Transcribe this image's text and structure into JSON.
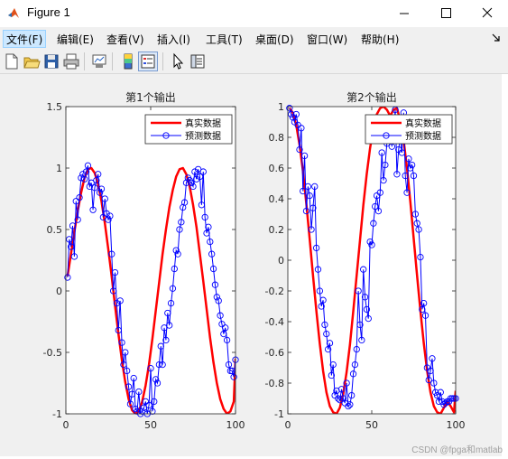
{
  "window": {
    "title": "Figure 1"
  },
  "menu": [
    {
      "label": "文件(F)"
    },
    {
      "label": "编辑(E)"
    },
    {
      "label": "查看(V)"
    },
    {
      "label": "插入(I)"
    },
    {
      "label": "工具(T)"
    },
    {
      "label": "桌面(D)"
    },
    {
      "label": "窗口(W)"
    },
    {
      "label": "帮助(H)"
    }
  ],
  "watermark": "CSDN @fpga和matlab",
  "colors": {
    "real": "#ff0000",
    "pred": "#0000ff",
    "figure_bg": "#f0f0f0",
    "accent": "#0078d7"
  },
  "chart_data": [
    {
      "type": "line",
      "title": "第1个输出",
      "xlim": [
        0,
        100
      ],
      "ylim": [
        -1,
        1.5
      ],
      "xticks": [
        0,
        50,
        100
      ],
      "yticks": [
        -1,
        -0.5,
        0,
        0.5,
        1,
        1.5
      ],
      "legend_position": "top-right",
      "grid": false,
      "series": [
        {
          "name": "真实数据",
          "x": [
            1,
            3,
            5,
            7,
            9,
            11,
            13,
            15,
            17,
            19,
            21,
            23,
            25,
            27,
            29,
            31,
            33,
            35,
            37,
            39,
            41,
            43,
            45,
            47,
            49,
            51,
            53,
            55,
            57,
            59,
            61,
            63,
            65,
            67,
            69,
            71,
            73,
            75,
            77,
            79,
            81,
            83,
            85,
            87,
            89,
            91,
            93,
            95,
            97,
            99,
            100
          ],
          "y": [
            0.12,
            0.3,
            0.48,
            0.65,
            0.8,
            0.92,
            0.99,
            1.0,
            0.96,
            0.87,
            0.73,
            0.55,
            0.34,
            0.12,
            -0.12,
            -0.35,
            -0.56,
            -0.74,
            -0.88,
            -0.97,
            -1.0,
            -0.98,
            -0.9,
            -0.77,
            -0.6,
            -0.39,
            -0.16,
            0.07,
            0.3,
            0.5,
            0.68,
            0.82,
            0.93,
            0.99,
            1.0,
            0.95,
            0.85,
            0.7,
            0.52,
            0.3,
            0.08,
            -0.15,
            -0.38,
            -0.58,
            -0.75,
            -0.88,
            -0.96,
            -1.0,
            -0.98,
            -0.9,
            -0.55
          ]
        },
        {
          "name": "预测数据",
          "x": [
            1,
            2,
            3,
            4,
            5,
            6,
            7,
            8,
            9,
            10,
            11,
            12,
            13,
            14,
            15,
            16,
            17,
            18,
            19,
            20,
            21,
            22,
            23,
            24,
            25,
            26,
            27,
            28,
            29,
            30,
            31,
            32,
            33,
            34,
            35,
            36,
            37,
            38,
            39,
            40,
            41,
            42,
            43,
            44,
            45,
            46,
            47,
            48,
            49,
            50,
            51,
            52,
            53,
            54,
            55,
            56,
            57,
            58,
            59,
            60,
            61,
            62,
            63,
            64,
            65,
            66,
            67,
            68,
            69,
            70,
            71,
            72,
            73,
            74,
            75,
            76,
            77,
            78,
            79,
            80,
            81,
            82,
            83,
            84,
            85,
            86,
            87,
            88,
            89,
            90,
            91,
            92,
            93,
            94,
            95,
            96,
            97,
            98,
            99,
            100
          ],
          "y": [
            0.11,
            0.42,
            0.36,
            0.53,
            0.28,
            0.73,
            0.58,
            0.76,
            0.92,
            0.95,
            0.91,
            0.97,
            1.02,
            0.85,
            0.88,
            0.66,
            0.84,
            0.9,
            0.95,
            0.8,
            0.83,
            0.6,
            0.75,
            0.63,
            0.58,
            0.61,
            0.3,
            0.0,
            0.15,
            -0.1,
            -0.32,
            -0.08,
            -0.42,
            -0.6,
            -0.5,
            -0.65,
            -0.78,
            -0.92,
            -0.84,
            -0.71,
            -0.96,
            -0.98,
            -0.82,
            -1.0,
            -0.98,
            -0.95,
            -0.9,
            -1.0,
            -0.93,
            -0.63,
            -0.98,
            -0.9,
            -0.72,
            -0.75,
            -0.6,
            -0.45,
            -0.6,
            -0.3,
            -0.4,
            -0.18,
            -0.28,
            -0.1,
            0.02,
            0.18,
            0.33,
            0.3,
            0.5,
            0.56,
            0.68,
            0.72,
            0.88,
            0.92,
            0.9,
            0.88,
            0.85,
            0.97,
            0.91,
            0.99,
            0.93,
            0.7,
            0.97,
            0.6,
            0.47,
            0.52,
            0.4,
            0.3,
            0.18,
            0.05,
            -0.05,
            -0.08,
            -0.2,
            -0.27,
            -0.35,
            -0.3,
            -0.4,
            -0.6,
            -0.65,
            -0.65,
            -0.7,
            -0.56
          ]
        }
      ]
    },
    {
      "type": "line",
      "title": "第2个输出",
      "xlim": [
        0,
        100
      ],
      "ylim": [
        -1,
        1
      ],
      "xticks": [
        0,
        50,
        100
      ],
      "yticks": [
        -1,
        -0.8,
        -0.6,
        -0.4,
        -0.2,
        0,
        0.2,
        0.4,
        0.6,
        0.8,
        1
      ],
      "legend_position": "top-right",
      "grid": false,
      "series": [
        {
          "name": "真实数据",
          "x": [
            1,
            3,
            5,
            7,
            9,
            11,
            13,
            15,
            17,
            19,
            21,
            23,
            25,
            27,
            29,
            31,
            33,
            35,
            37,
            39,
            41,
            43,
            45,
            47,
            49,
            51,
            53,
            55,
            57,
            59,
            61,
            63,
            65,
            67,
            69,
            71,
            73,
            75,
            77,
            79,
            81,
            83,
            85,
            87,
            89,
            91,
            93,
            95,
            97,
            99,
            100
          ],
          "y": [
            0.99,
            0.96,
            0.88,
            0.75,
            0.58,
            0.37,
            0.14,
            -0.1,
            -0.33,
            -0.54,
            -0.72,
            -0.86,
            -0.95,
            -0.99,
            -1.0,
            -0.96,
            -0.87,
            -0.73,
            -0.55,
            -0.33,
            -0.1,
            0.13,
            0.36,
            0.56,
            0.73,
            0.86,
            0.95,
            0.99,
            1.0,
            0.98,
            0.94,
            0.98,
            0.99,
            0.91,
            0.78,
            0.6,
            0.38,
            0.14,
            -0.1,
            -0.33,
            -0.54,
            -0.72,
            -0.86,
            -0.95,
            -0.99,
            -1.0,
            -0.96,
            -0.92,
            -0.95,
            -0.99,
            -0.85
          ]
        },
        {
          "name": "预测数据",
          "x": [
            1,
            2,
            3,
            4,
            5,
            6,
            7,
            8,
            9,
            10,
            11,
            12,
            13,
            14,
            15,
            16,
            17,
            18,
            19,
            20,
            21,
            22,
            23,
            24,
            25,
            26,
            27,
            28,
            29,
            30,
            31,
            32,
            33,
            34,
            35,
            36,
            37,
            38,
            39,
            40,
            41,
            42,
            43,
            44,
            45,
            46,
            47,
            48,
            49,
            50,
            51,
            52,
            53,
            54,
            55,
            56,
            57,
            58,
            59,
            60,
            61,
            62,
            63,
            64,
            65,
            66,
            67,
            68,
            69,
            70,
            71,
            72,
            73,
            74,
            75,
            76,
            77,
            78,
            79,
            80,
            81,
            82,
            83,
            84,
            85,
            86,
            87,
            88,
            89,
            90,
            91,
            92,
            93,
            94,
            95,
            96,
            97,
            98,
            99,
            100
          ],
          "y": [
            0.99,
            0.95,
            0.93,
            0.9,
            0.95,
            0.88,
            0.72,
            0.86,
            0.45,
            0.68,
            0.32,
            0.48,
            0.42,
            0.2,
            0.34,
            0.48,
            0.08,
            -0.06,
            -0.2,
            -0.3,
            -0.26,
            -0.42,
            -0.48,
            -0.58,
            -0.54,
            -0.75,
            -0.68,
            -0.88,
            -0.85,
            -0.9,
            -0.91,
            -0.84,
            -0.9,
            -0.93,
            -0.8,
            -0.95,
            -0.94,
            -0.88,
            -0.74,
            -0.68,
            -0.58,
            -0.2,
            -0.42,
            -0.52,
            -0.06,
            -0.24,
            -0.32,
            -0.38,
            0.12,
            0.1,
            0.24,
            0.35,
            0.42,
            0.32,
            0.44,
            0.7,
            0.52,
            0.62,
            0.76,
            0.88,
            0.9,
            0.74,
            0.84,
            0.98,
            0.56,
            0.72,
            0.8,
            0.7,
            0.96,
            0.55,
            0.44,
            0.66,
            0.6,
            0.62,
            0.55,
            0.3,
            0.24,
            0.2,
            0.02,
            -0.32,
            -0.28,
            -0.36,
            -0.7,
            -0.78,
            -0.72,
            -0.64,
            -0.8,
            -0.86,
            -0.88,
            -0.92,
            -0.86,
            -0.92,
            -0.94,
            -0.93,
            -0.92,
            -0.92,
            -0.9,
            -0.9,
            -0.9,
            -0.9
          ]
        }
      ]
    }
  ]
}
